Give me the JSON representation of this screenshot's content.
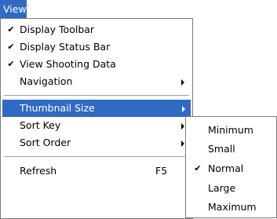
{
  "colors": {
    "highlight": "#316ac5",
    "menu_background": "#ffffff",
    "menu_border": "#7a7a7a",
    "separator": "#a0a0a0",
    "text": "#000000",
    "highlight_text": "#ffffff"
  },
  "menubar": {
    "view_label": "View"
  },
  "menu": {
    "check_glyph": "✔",
    "items": [
      {
        "label": "Display Toolbar",
        "checked": true,
        "icon": "checkmark-icon"
      },
      {
        "label": "Display Status Bar",
        "checked": true,
        "icon": "checkmark-icon"
      },
      {
        "label": "View Shooting Data",
        "checked": true,
        "icon": "checkmark-icon"
      },
      {
        "label": "Navigation",
        "has_submenu": true,
        "icon": "submenu-arrow-icon"
      },
      {
        "label": "Thumbnail Size",
        "has_submenu": true,
        "highlighted": true,
        "icon": "submenu-arrow-icon"
      },
      {
        "label": "Sort Key",
        "has_submenu": true,
        "icon": "submenu-arrow-icon"
      },
      {
        "label": "Sort Order",
        "has_submenu": true,
        "icon": "submenu-arrow-icon"
      },
      {
        "label": "Refresh",
        "shortcut": "F5"
      }
    ]
  },
  "submenu": {
    "items": [
      {
        "label": "Minimum"
      },
      {
        "label": "Small"
      },
      {
        "label": "Normal",
        "checked": true,
        "icon": "checkmark-icon"
      },
      {
        "label": "Large"
      },
      {
        "label": "Maximum"
      }
    ]
  }
}
